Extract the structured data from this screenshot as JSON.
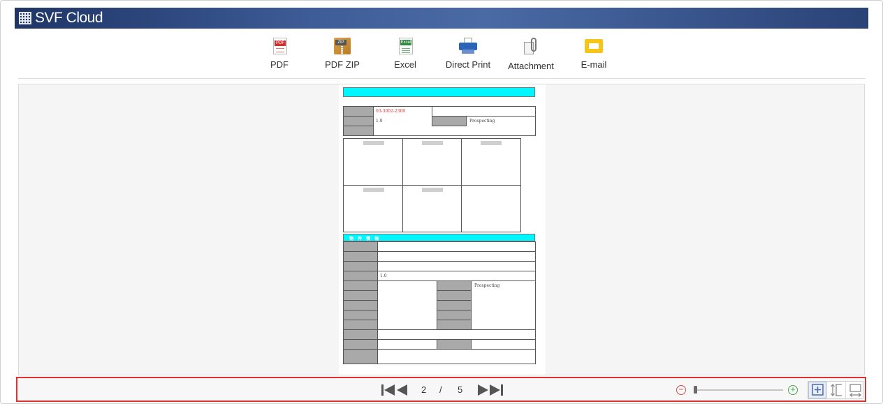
{
  "header": {
    "app_title": "SVF Cloud"
  },
  "toolbar": {
    "items": [
      {
        "label": "PDF",
        "icon": "pdf-file-icon"
      },
      {
        "label": "PDF ZIP",
        "icon": "zip-archive-icon"
      },
      {
        "label": "Excel",
        "icon": "excel-file-icon"
      },
      {
        "label": "Direct Print",
        "icon": "printer-icon"
      },
      {
        "label": "Attachment",
        "icon": "paperclip-icon"
      },
      {
        "label": "E-mail",
        "icon": "envelope-icon"
      }
    ]
  },
  "document": {
    "code": "03-3002-2300",
    "version_top": "1.0",
    "status_top": "Prospecting",
    "section_title": "物 件 情 報",
    "version_bottom": "1.0",
    "status_bottom": "Prospecting"
  },
  "pagination": {
    "current_page": "2",
    "separator": "/",
    "total_pages": "5"
  },
  "colors": {
    "header_bar": "#2a4377",
    "form_heading": "#00f7ff",
    "highlight_border": "#e03030"
  }
}
